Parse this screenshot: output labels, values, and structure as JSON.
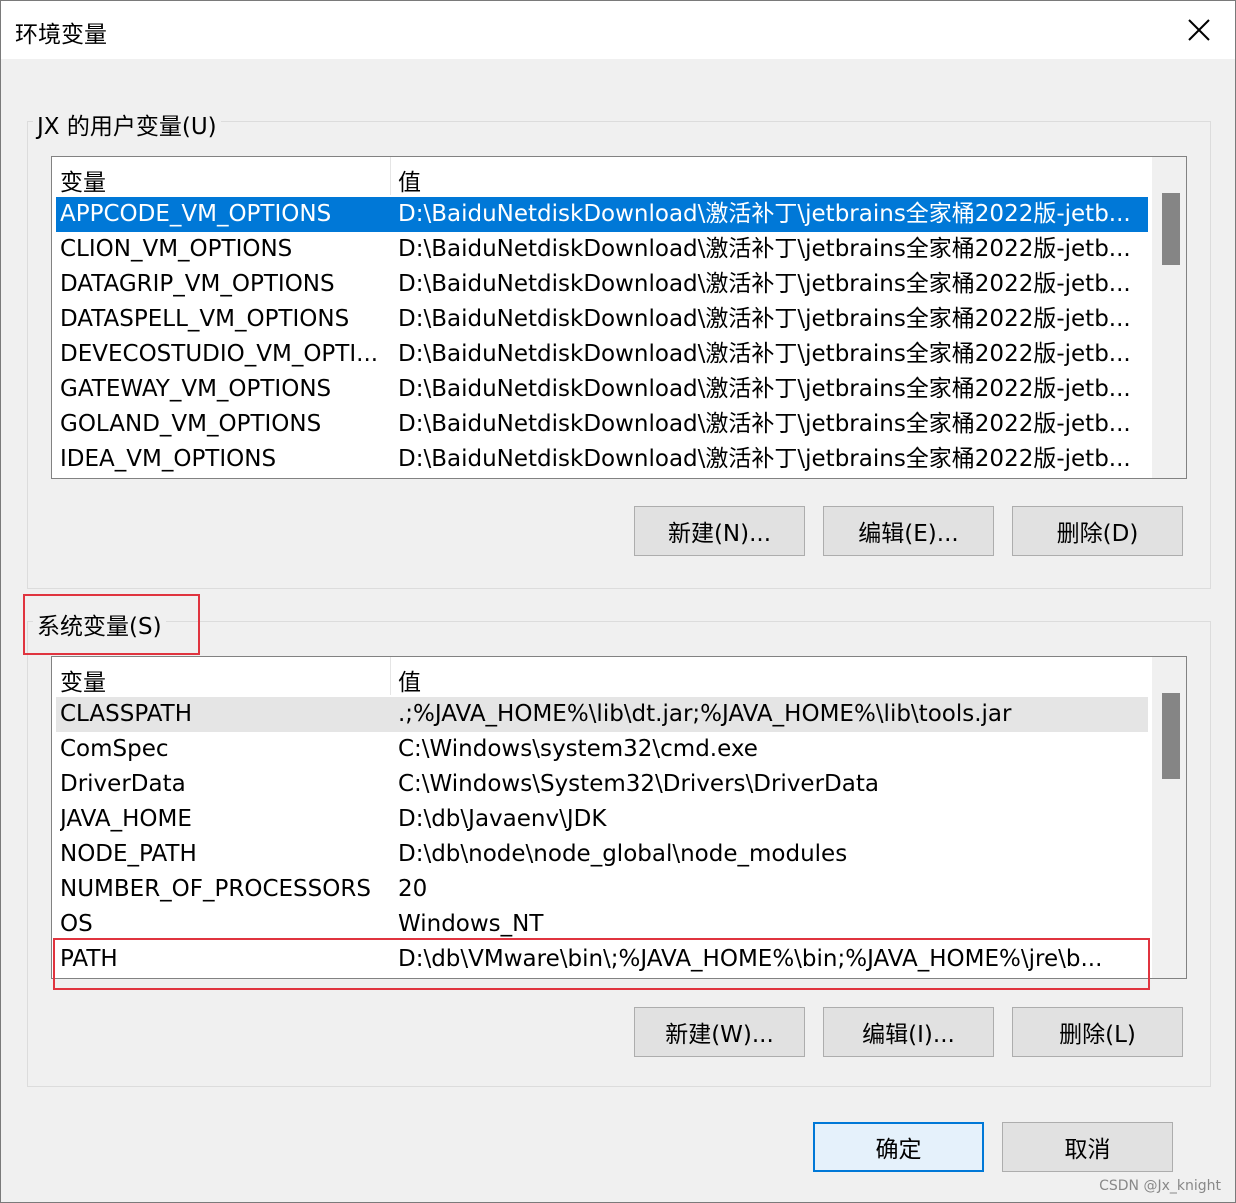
{
  "window": {
    "title": "环境变量"
  },
  "user_group": {
    "label": "JX 的用户变量(U)",
    "columns": [
      "变量",
      "值"
    ],
    "rows": [
      {
        "name": "APPCODE_VM_OPTIONS",
        "value": "D:\\BaiduNetdiskDownload\\激活补丁\\jetbrains全家桶2022版-jetb..."
      },
      {
        "name": "CLION_VM_OPTIONS",
        "value": "D:\\BaiduNetdiskDownload\\激活补丁\\jetbrains全家桶2022版-jetb..."
      },
      {
        "name": "DATAGRIP_VM_OPTIONS",
        "value": "D:\\BaiduNetdiskDownload\\激活补丁\\jetbrains全家桶2022版-jetb..."
      },
      {
        "name": "DATASPELL_VM_OPTIONS",
        "value": "D:\\BaiduNetdiskDownload\\激活补丁\\jetbrains全家桶2022版-jetb..."
      },
      {
        "name": "DEVECOSTUDIO_VM_OPTI...",
        "value": "D:\\BaiduNetdiskDownload\\激活补丁\\jetbrains全家桶2022版-jetb..."
      },
      {
        "name": "GATEWAY_VM_OPTIONS",
        "value": "D:\\BaiduNetdiskDownload\\激活补丁\\jetbrains全家桶2022版-jetb..."
      },
      {
        "name": "GOLAND_VM_OPTIONS",
        "value": "D:\\BaiduNetdiskDownload\\激活补丁\\jetbrains全家桶2022版-jetb..."
      },
      {
        "name": "IDEA_VM_OPTIONS",
        "value": "D:\\BaiduNetdiskDownload\\激活补丁\\jetbrains全家桶2022版-jetb..."
      }
    ],
    "buttons": {
      "new": "新建(N)...",
      "edit": "编辑(E)...",
      "delete": "删除(D)"
    }
  },
  "system_group": {
    "label": "系统变量(S)",
    "columns": [
      "变量",
      "值"
    ],
    "rows": [
      {
        "name": "CLASSPATH",
        "value": ".;%JAVA_HOME%\\lib\\dt.jar;%JAVA_HOME%\\lib\\tools.jar"
      },
      {
        "name": "ComSpec",
        "value": "C:\\Windows\\system32\\cmd.exe"
      },
      {
        "name": "DriverData",
        "value": "C:\\Windows\\System32\\Drivers\\DriverData"
      },
      {
        "name": "JAVA_HOME",
        "value": "D:\\db\\Javaenv\\JDK"
      },
      {
        "name": "NODE_PATH",
        "value": "D:\\db\\node\\node_global\\node_modules"
      },
      {
        "name": "NUMBER_OF_PROCESSORS",
        "value": "20"
      },
      {
        "name": "OS",
        "value": "Windows_NT"
      },
      {
        "name": "PATH",
        "value": "D:\\db\\VMware\\bin\\;%JAVA_HOME%\\bin;%JAVA_HOME%\\jre\\b..."
      }
    ],
    "buttons": {
      "new": "新建(W)...",
      "edit": "编辑(I)...",
      "delete": "删除(L)"
    }
  },
  "footer": {
    "ok": "确定",
    "cancel": "取消"
  },
  "watermark": "CSDN @Jx_knight",
  "colors": {
    "selection": "#0078d7",
    "highlight_box": "#e0343f"
  }
}
